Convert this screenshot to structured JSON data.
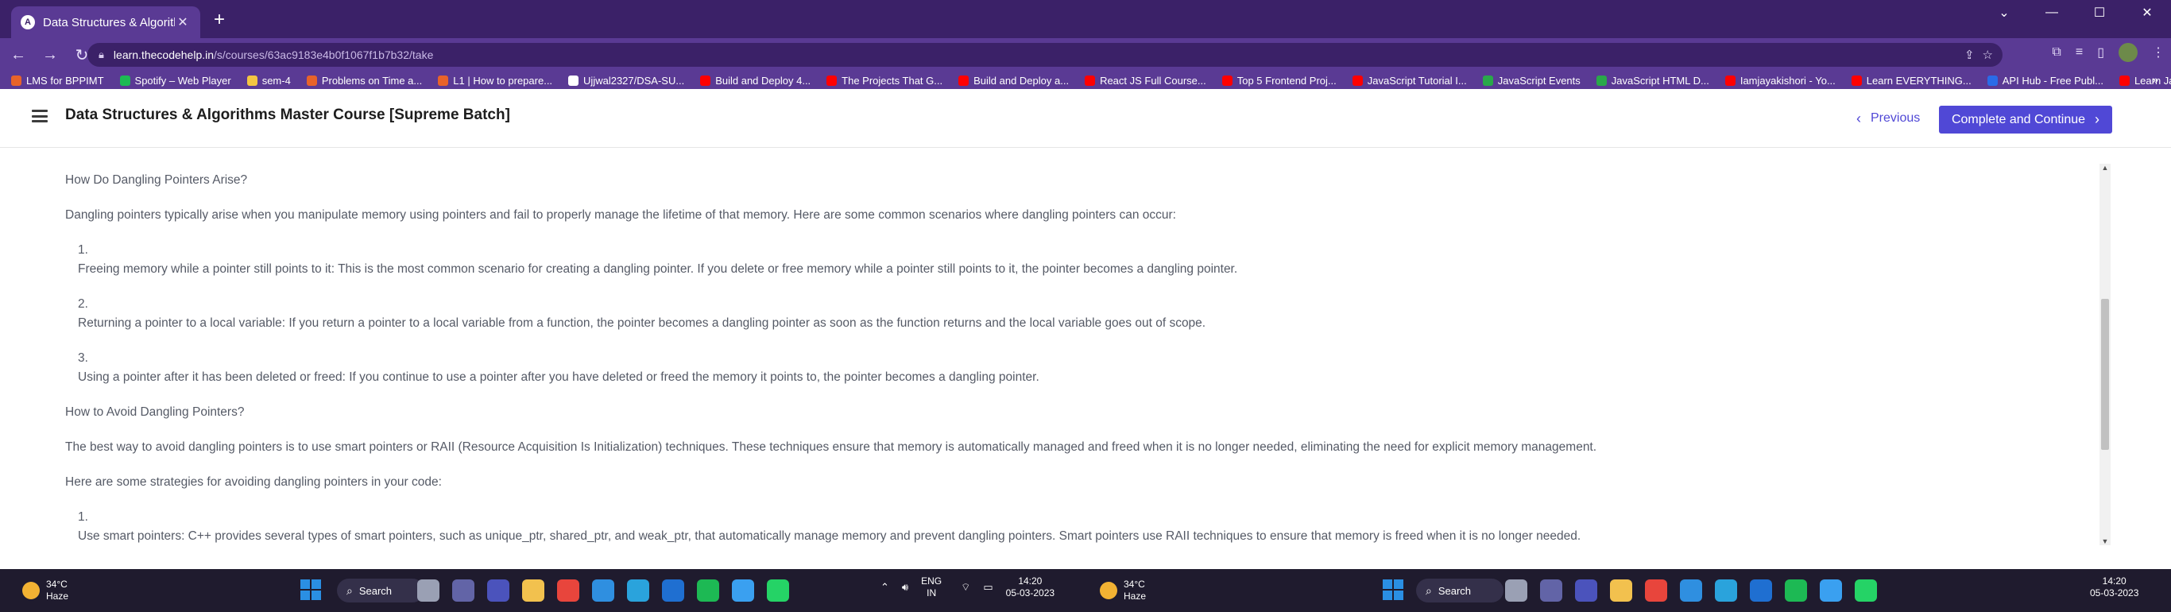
{
  "browser": {
    "tab": {
      "title": "Data Structures & Algorithms M",
      "favicon": "codehelp-logo-icon",
      "close_label": "✕"
    },
    "new_tab_label": "+",
    "url_host": "learn.thecodehelp.in",
    "url_path": "/s/courses/63ac9183e4b0f1067f1b7b32/take",
    "bookmarks": [
      {
        "label": "LMS for BPPIMT",
        "color": "#e8632a"
      },
      {
        "label": "Spotify – Web Player",
        "color": "#1db954"
      },
      {
        "label": "sem-4",
        "color": "#f4c542"
      },
      {
        "label": "Problems on Time a...",
        "color": "#e8632a"
      },
      {
        "label": "L1 | How to prepare...",
        "color": "#e8632a"
      },
      {
        "label": "Ujjwal2327/DSA-SU...",
        "color": "#ffffff"
      },
      {
        "label": "Build and Deploy 4...",
        "color": "#ff0000"
      },
      {
        "label": "The Projects That G...",
        "color": "#ff0000"
      },
      {
        "label": "Build and Deploy a...",
        "color": "#ff0000"
      },
      {
        "label": "React JS Full Course...",
        "color": "#ff0000"
      },
      {
        "label": "Top 5 Frontend Proj...",
        "color": "#ff0000"
      },
      {
        "label": "JavaScript Tutorial I...",
        "color": "#ff0000"
      },
      {
        "label": "JavaScript Events",
        "color": "#2aa84a"
      },
      {
        "label": "JavaScript HTML D...",
        "color": "#2aa84a"
      },
      {
        "label": "Iamjayakishori - Yo...",
        "color": "#ff0000"
      },
      {
        "label": "Learn EVERYTHING...",
        "color": "#ff0000"
      },
      {
        "label": "API Hub - Free Publ...",
        "color": "#2a6be8"
      },
      {
        "label": "Learn JavaScript by...",
        "color": "#ff0000"
      }
    ],
    "bookmarks_more": "»"
  },
  "course": {
    "title": "Data Structures & Algorithms Master Course [Supreme Batch]",
    "previous_label": "Previous",
    "continue_label": "Complete and Continue"
  },
  "lesson": {
    "heading1": "How Do Dangling Pointers Arise?",
    "para1": "Dangling pointers typically arise when you manipulate memory using pointers and fail to properly manage the lifetime of that memory. Here are some common scenarios where dangling pointers can occur:",
    "items1": [
      {
        "num": "1.",
        "text": "Freeing memory while a pointer still points to it: This is the most common scenario for creating a dangling pointer. If you delete or free memory while a pointer still points to it, the pointer becomes a dangling pointer."
      },
      {
        "num": "2.",
        "text": "Returning a pointer to a local variable: If you return a pointer to a local variable from a function, the pointer becomes a dangling pointer as soon as the function returns and the local variable goes out of scope."
      },
      {
        "num": "3.",
        "text": "Using a pointer after it has been deleted or freed: If you continue to use a pointer after you have deleted or freed the memory it points to, the pointer becomes a dangling pointer."
      }
    ],
    "heading2": "How to Avoid Dangling Pointers?",
    "para2": "The best way to avoid dangling pointers is to use smart pointers or RAII (Resource Acquisition Is Initialization) techniques. These techniques ensure that memory is automatically managed and freed when it is no longer needed, eliminating the need for explicit memory management.",
    "para3": "Here are some strategies for avoiding dangling pointers in your code:",
    "items2": [
      {
        "num": "1.",
        "text": "Use smart pointers: C++ provides several types of smart pointers, such as unique_ptr, shared_ptr, and weak_ptr, that automatically manage memory and prevent dangling pointers. Smart pointers use RAII techniques to ensure that memory is freed when it is no longer needed."
      }
    ]
  },
  "taskbar": {
    "weather_temp": "34°C",
    "weather_desc": "Haze",
    "search_label": "Search",
    "lang_line1": "ENG",
    "lang_line2": "IN",
    "time": "14:20",
    "date": "05-03-2023",
    "apps": [
      {
        "name": "task-view",
        "color": "#9aa0b4"
      },
      {
        "name": "teams",
        "color": "#6264a7"
      },
      {
        "name": "teams-work",
        "color": "#4b53bc"
      },
      {
        "name": "file-explorer",
        "color": "#f2c14e"
      },
      {
        "name": "chrome",
        "color": "#e8453c"
      },
      {
        "name": "vscode",
        "color": "#2f8fe0"
      },
      {
        "name": "telegram",
        "color": "#2aa3dc"
      },
      {
        "name": "mail",
        "color": "#1f6fd1"
      },
      {
        "name": "spotify",
        "color": "#1db954"
      },
      {
        "name": "cortana",
        "color": "#3aa0f0"
      },
      {
        "name": "whatsapp",
        "color": "#25d366"
      }
    ]
  }
}
